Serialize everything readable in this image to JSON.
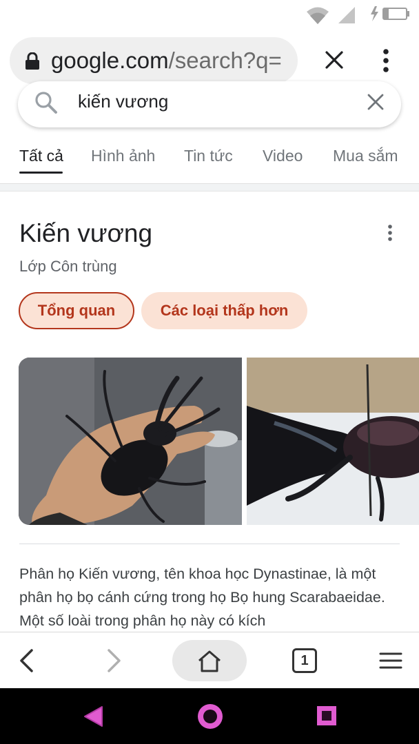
{
  "browser": {
    "url_domain": "google.com",
    "url_path": "/search?q=",
    "icons": [
      "lock-icon",
      "close-icon",
      "more-vert-icon"
    ]
  },
  "search": {
    "query": "kiến vương"
  },
  "tabs": [
    {
      "label": "Tất cả",
      "active": true
    },
    {
      "label": "Hình ảnh",
      "active": false
    },
    {
      "label": "Tin tức",
      "active": false
    },
    {
      "label": "Video",
      "active": false
    },
    {
      "label": "Mua sắm",
      "active": false
    }
  ],
  "knowledge_panel": {
    "title": "Kiến vương",
    "subtitle": "Lớp Côn trùng",
    "chips": [
      {
        "label": "Tổng quan",
        "active": true
      },
      {
        "label": "Các loại thấp hơn",
        "active": false
      }
    ],
    "description": "Phân họ Kiến vương, tên khoa học Dynastinae, là một phân họ bọ cánh cứng trong họ Bọ hung Scarabaeidae. Một số loài trong phân họ này có kích"
  },
  "toolbar": {
    "tab_count": "1"
  },
  "colors": {
    "chip_text": "#b3361c",
    "chip_bg": "#fbe2d5",
    "nav_accent": "#e05bd0"
  }
}
